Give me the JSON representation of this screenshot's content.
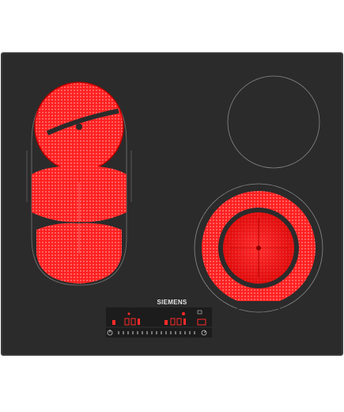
{
  "brand": {
    "name": "SIEMENS",
    "color": "#e6e6e6"
  },
  "hob": {
    "surface_color": "#2a2a2a",
    "frame_color": "#3a3a3a",
    "heat_color": "#ff1a1a",
    "glow_color": "#c40000"
  },
  "icons": {
    "power": "power-icon",
    "timer": "timer-icon",
    "lock": "lock-icon"
  }
}
